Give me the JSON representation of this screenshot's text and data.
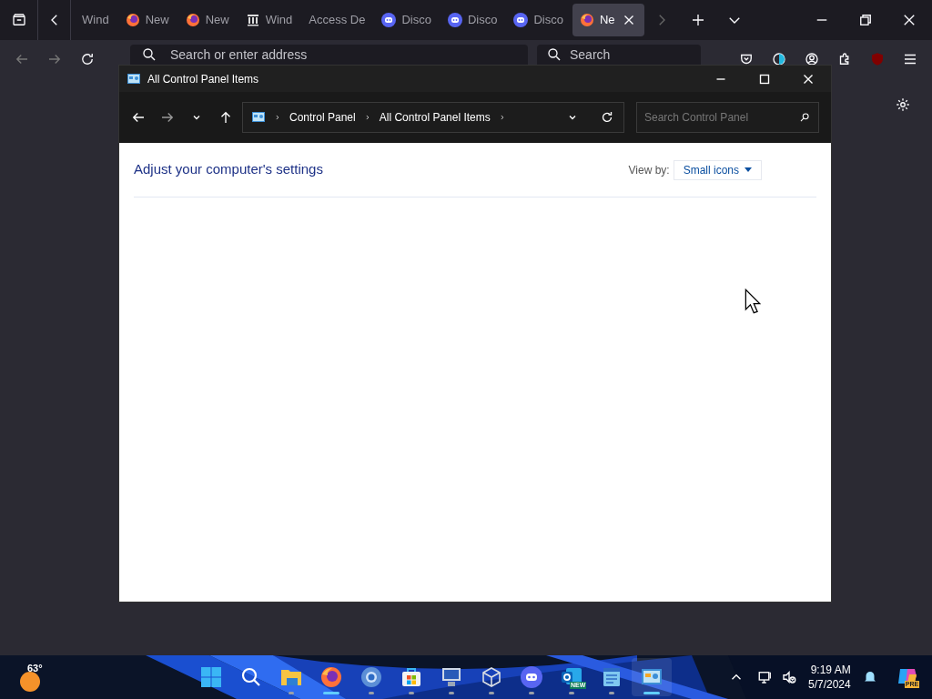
{
  "browser": {
    "tabs": [
      {
        "label": "Wind",
        "kind": "none",
        "selected": false
      },
      {
        "label": "New",
        "kind": "firefox",
        "selected": false
      },
      {
        "label": "New",
        "kind": "firefox",
        "selected": false
      },
      {
        "label": "Wind",
        "kind": "columns",
        "selected": false
      },
      {
        "label": "Access De",
        "kind": "none",
        "selected": false
      },
      {
        "label": "Disco",
        "kind": "discord",
        "selected": false
      },
      {
        "label": "Disco",
        "kind": "discord",
        "selected": false
      },
      {
        "label": "Disco",
        "kind": "discord",
        "selected": false
      },
      {
        "label": "Ne",
        "kind": "firefox",
        "selected": true
      }
    ],
    "address_placeholder": "Search or enter address",
    "search_placeholder": "Search"
  },
  "window": {
    "title": "All Control Panel Items",
    "breadcrumb": [
      "Control Panel",
      "All Control Panel Items"
    ],
    "search_placeholder": "Search Control Panel",
    "heading": "Adjust your computer's settings",
    "view_by_label": "View by:",
    "view_by_value": "Small icons"
  },
  "taskbar": {
    "weather": "63°",
    "apps": [
      {
        "kind": "start",
        "running": false,
        "focused": false,
        "selected": false
      },
      {
        "kind": "search",
        "running": false,
        "focused": false,
        "selected": false
      },
      {
        "kind": "folder",
        "running": true,
        "focused": false,
        "selected": false
      },
      {
        "kind": "firefox",
        "focused": true,
        "selected": false
      },
      {
        "kind": "chrome",
        "running": true,
        "focused": false,
        "selected": false
      },
      {
        "kind": "store",
        "running": true,
        "focused": false,
        "selected": false
      },
      {
        "kind": "monitor",
        "running": true,
        "focused": false,
        "selected": false
      },
      {
        "kind": "cube",
        "running": true,
        "focused": false,
        "selected": false
      },
      {
        "kind": "discord",
        "running": true,
        "focused": false,
        "selected": false
      },
      {
        "kind": "outlook",
        "running": true,
        "focused": false,
        "selected": false,
        "badge": "NEW"
      },
      {
        "kind": "notepad",
        "running": true,
        "focused": false,
        "selected": false
      },
      {
        "kind": "controlpanel",
        "focused": true,
        "selected": true
      }
    ],
    "time": "9:19 AM",
    "date": "5/7/2024",
    "copilot_badge": "PRE"
  }
}
